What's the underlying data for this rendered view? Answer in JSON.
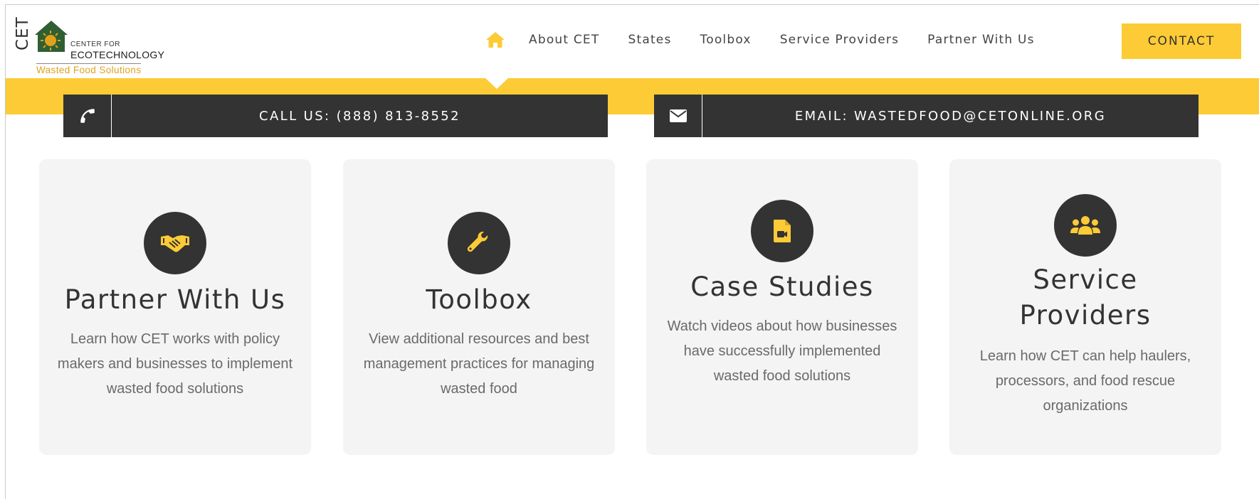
{
  "logo": {
    "mark": "CET",
    "line1": "CENTER FOR",
    "line2": "ECOTECHNOLOGY",
    "tagline": "Wasted Food Solutions"
  },
  "nav": {
    "home_icon": "home-icon",
    "items": [
      "About CET",
      "States",
      "Toolbox",
      "Service Providers",
      "Partner With Us"
    ],
    "contact_label": "CONTACT"
  },
  "contact_bar": {
    "call_icon": "phone-icon",
    "call_text": "CALL US: (888) 813-8552",
    "email_icon": "envelope-icon",
    "email_text": "EMAIL: WASTEDFOOD@CETONLINE.ORG"
  },
  "cards": [
    {
      "icon": "handshake-icon",
      "title": "Partner With Us",
      "description": "Learn how CET works with policy makers and businesses to implement wasted food solutions"
    },
    {
      "icon": "wrench-icon",
      "title": "Toolbox",
      "description": "View additional resources and best management practices for managing wasted food"
    },
    {
      "icon": "video-file-icon",
      "title": "Case Studies",
      "description": "Watch videos about how businesses have successfully implemented wasted food solutions"
    },
    {
      "icon": "users-icon",
      "title": "Service Providers",
      "description": "Learn how CET can help haulers, processors, and food rescue organizations"
    }
  ],
  "colors": {
    "accent": "#fccb36",
    "dark": "#333333",
    "card_bg": "#f4f4f4",
    "logo_orange": "#e0a21a",
    "logo_green": "#2f5f33"
  }
}
